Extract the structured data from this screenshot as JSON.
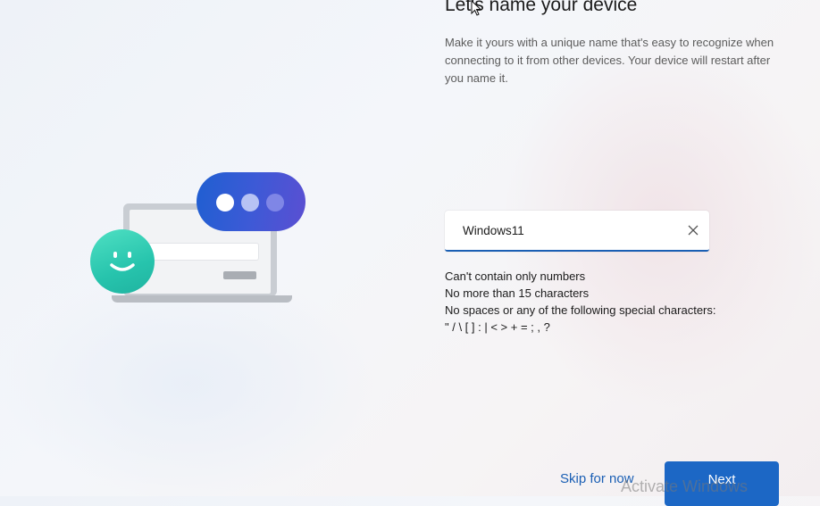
{
  "page": {
    "title": "Let's name your device",
    "description": "Make it yours with a unique name that's easy to recognize when connecting to it from other devices. Your device will restart after you name it."
  },
  "name_field": {
    "value": "Windows11",
    "clear_icon": "close-icon"
  },
  "rules": [
    "Can't contain only numbers",
    "No more than 15 characters",
    "No spaces or any of the following special characters:",
    "\" / \\ [ ] : | < > + = ; , ?"
  ],
  "footer": {
    "skip_label": "Skip for now",
    "next_label": "Next",
    "watermark": "Activate Windows"
  },
  "colors": {
    "accent": "#1c67c5",
    "link": "#1a5fb4"
  },
  "illustration": {
    "icons": [
      "laptop-icon",
      "chat-bubble-icon",
      "smiley-icon"
    ]
  }
}
